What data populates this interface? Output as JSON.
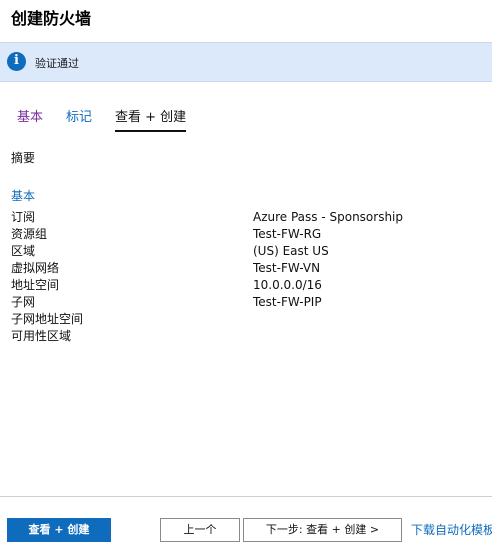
{
  "header": {
    "title": "创建防火墙"
  },
  "banner": {
    "message": "验证通过",
    "icon": "info-icon"
  },
  "tabs": [
    {
      "label": "基本"
    },
    {
      "label": "标记"
    },
    {
      "label": "查看 + 创建"
    }
  ],
  "summary": {
    "label": "摘要",
    "section_title": "基本",
    "rows": [
      {
        "key": "订阅",
        "value": "Azure Pass - Sponsorship"
      },
      {
        "key": "资源组",
        "value": "Test-FW-RG"
      },
      {
        "key": "区域",
        "value": "(US) East US"
      },
      {
        "key": "虚拟网络",
        "value": "Test-FW-VN"
      },
      {
        "key": "地址空间",
        "value": "10.0.0.0/16"
      },
      {
        "key": "子网",
        "value": "Test-FW-PIP"
      },
      {
        "key": "子网地址空间",
        "value": ""
      },
      {
        "key": "可用性区域",
        "value": ""
      }
    ]
  },
  "footer": {
    "create_label": "查看 + 创建",
    "prev_label": "上一个",
    "next_label": "下一步: 查看 + 创建 >",
    "download_label": "下载自动化模板"
  },
  "colors": {
    "accent": "#0f6cbd",
    "banner_bg": "#dce9fb",
    "tab_visited": "#7a2ea0"
  }
}
